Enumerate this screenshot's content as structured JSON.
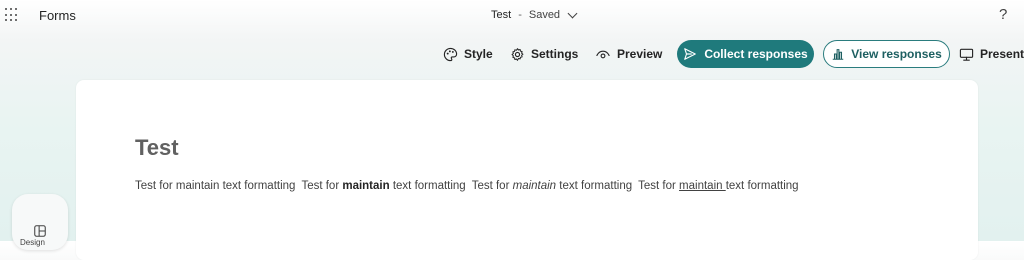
{
  "header": {
    "app_name": "Forms",
    "doc_title": "Test",
    "separator": "-",
    "status": "Saved",
    "help": "?"
  },
  "toolbar": {
    "style": "Style",
    "settings": "Settings",
    "preview": "Preview",
    "collect": "Collect responses",
    "view": "View responses",
    "present": "Present"
  },
  "form": {
    "title": "Test",
    "description": {
      "p1_a": "Test for maintain text formatting",
      "p2_a": "Test for ",
      "p2_bold": "maintain",
      "p2_b": " text formatting",
      "p3_a": "Test for ",
      "p3_italic": "maintain",
      "p3_b": " text formatting",
      "p4_a": "Test for ",
      "p4_underline": "maintain ",
      "p4_b": "text formatting"
    }
  },
  "side": {
    "label": "Design"
  },
  "colors": {
    "accent": "#1f7a7c",
    "accent_border": "#2a7c7e"
  }
}
